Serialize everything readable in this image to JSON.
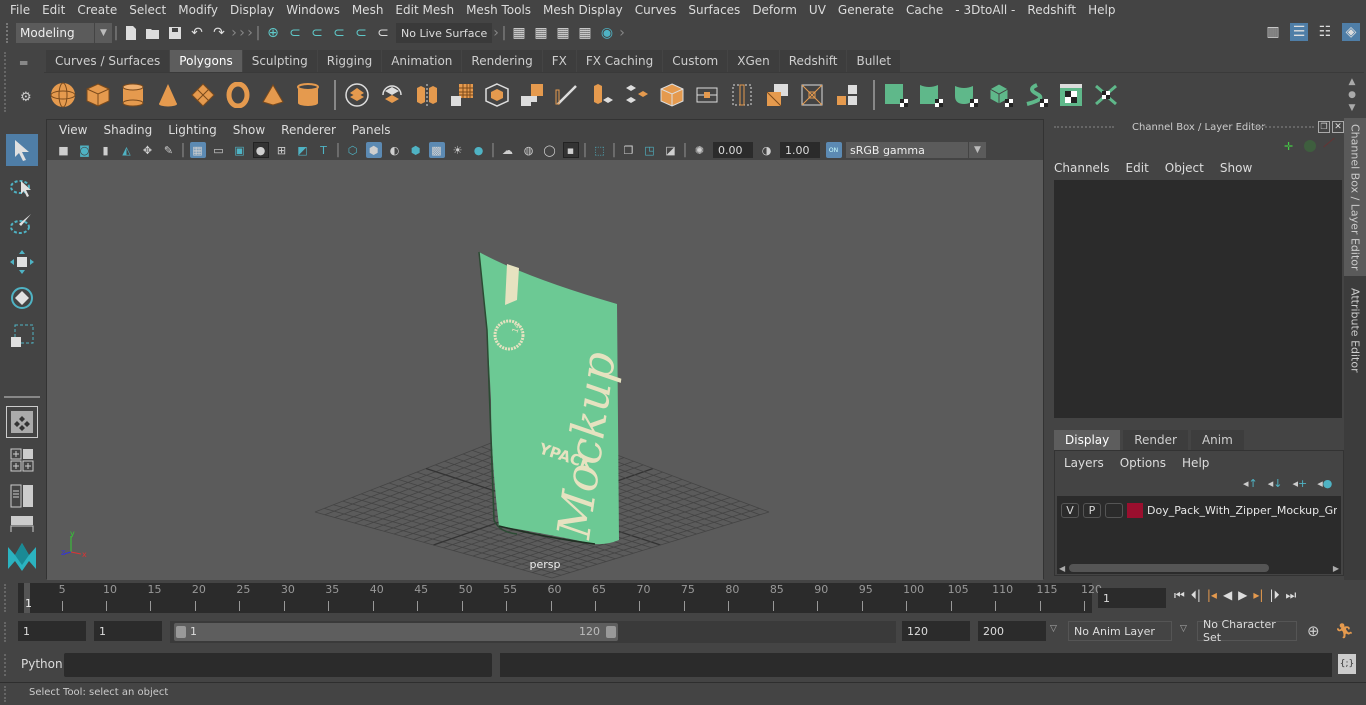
{
  "menubar": [
    "File",
    "Edit",
    "Create",
    "Select",
    "Modify",
    "Display",
    "Windows",
    "Mesh",
    "Edit Mesh",
    "Mesh Tools",
    "Mesh Display",
    "Curves",
    "Surfaces",
    "Deform",
    "UV",
    "Generate",
    "Cache",
    "- 3DtoAll -",
    "Redshift",
    "Help"
  ],
  "statusline": {
    "mode": "Modeling",
    "live_surface": "No Live Surface"
  },
  "shelf": {
    "tabs": [
      "Curves / Surfaces",
      "Polygons",
      "Sculpting",
      "Rigging",
      "Animation",
      "Rendering",
      "FX",
      "FX Caching",
      "Custom",
      "XGen",
      "Redshift",
      "Bullet"
    ],
    "active_tab": "Polygons",
    "orange_icons": [
      "poly-sphere",
      "poly-cube",
      "poly-cylinder",
      "poly-cone",
      "poly-plane",
      "poly-torus",
      "poly-pyramid",
      "poly-pipe"
    ],
    "mid_icons": [
      "combine",
      "separate",
      "mirror",
      "smooth",
      "bevel-box",
      "subdivide",
      "multi-cut",
      "extrude",
      "bridge",
      "append",
      "crease-box",
      "edge-loop",
      "insert-edge",
      "boolean",
      "target-weld",
      "merge"
    ],
    "green_icons": [
      "uv-planar",
      "uv-cylindrical",
      "uv-spherical",
      "uv-automatic",
      "uv-unfold",
      "uv-editor",
      "uv-layout"
    ]
  },
  "viewport": {
    "menu": [
      "View",
      "Shading",
      "Lighting",
      "Show",
      "Renderer",
      "Panels"
    ],
    "exposure": "0.00",
    "gamma": "1.00",
    "color_space": "sRGB gamma",
    "color_mgmt_badge": "ON",
    "camera_label": "persp",
    "axis": {
      "x": "x",
      "y": "y",
      "z": "z"
    },
    "object": {
      "brand_text": "YPACK",
      "script_text": "Mockup",
      "color": "#6cc994"
    }
  },
  "channel_box": {
    "title": "Channel Box / Layer Editor",
    "menu": [
      "Channels",
      "Edit",
      "Object",
      "Show"
    ]
  },
  "layer_editor": {
    "tabs": [
      "Display",
      "Render",
      "Anim"
    ],
    "active_tab": "Display",
    "menu": [
      "Layers",
      "Options",
      "Help"
    ],
    "layers": [
      {
        "v": "V",
        "p": "P",
        "color": "#9a0f2e",
        "name": "Doy_Pack_With_Zipper_Mockup_Green"
      }
    ]
  },
  "side_tabs": [
    "Channel Box / Layer Editor",
    "Attribute Editor"
  ],
  "timeline": {
    "ticks": [
      5,
      10,
      15,
      20,
      25,
      30,
      35,
      40,
      45,
      50,
      55,
      60,
      65,
      70,
      75,
      80,
      85,
      90,
      95,
      100,
      105,
      110,
      115,
      120
    ],
    "start_label": "1",
    "current_frame": "1"
  },
  "range": {
    "start": "1",
    "playback_start": "1",
    "slider_min": "1",
    "slider_max": "120",
    "playback_end": "120",
    "end": "200",
    "anim_layer": "No Anim Layer",
    "character_set": "No Character Set"
  },
  "cmdline": {
    "label": "Python"
  },
  "help_line": "Select Tool: select an object"
}
